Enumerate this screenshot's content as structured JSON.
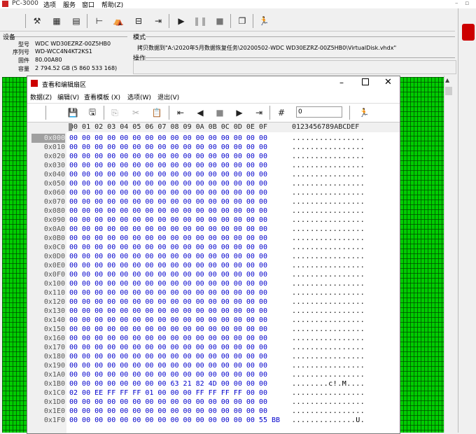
{
  "app": {
    "title": "PC-3000"
  },
  "menubar": [
    "选项",
    "服务",
    "窗口",
    "帮助(Z)"
  ],
  "device": {
    "group_label": "设备",
    "model_label": "型号",
    "model": "WDC WD30EZRZ-00Z5HB0",
    "serial_label": "序列号",
    "serial": "WD-WCC4N4KT2KS1",
    "fw_label": "固件",
    "fw": "80.00A80",
    "capacity_label": "容量",
    "capacity": "2 794.52 GB (5 860 533 168)"
  },
  "mode": {
    "label": "模式",
    "text": "拷贝数据到\"A:\\2020年5月数据恢复任务\\20200502-WDC WD30EZRZ-00Z5HB0\\VirtualDisk.vhdx\""
  },
  "operation": {
    "label": "操作"
  },
  "window": {
    "title": "查看和编辑扇区",
    "menu": [
      "数据(Z)",
      "编辑(V)",
      "查看模板 (X)",
      "选项(W)",
      "退出(V)"
    ],
    "offset_value": "0",
    "header_cols": "00 01 02 03 04 05 06 07 08 09 0A 0B 0C 0D 0E 0F",
    "header_ascii": "0123456789ABCDEF",
    "rows": [
      {
        "addr": "0x000",
        "bytes": "00 00 00 00 00 00 00 00 00 00 00 00 00 00 00 00",
        "ascii": "................"
      },
      {
        "addr": "0x010",
        "bytes": "00 00 00 00 00 00 00 00 00 00 00 00 00 00 00 00",
        "ascii": "................"
      },
      {
        "addr": "0x020",
        "bytes": "00 00 00 00 00 00 00 00 00 00 00 00 00 00 00 00",
        "ascii": "................"
      },
      {
        "addr": "0x030",
        "bytes": "00 00 00 00 00 00 00 00 00 00 00 00 00 00 00 00",
        "ascii": "................"
      },
      {
        "addr": "0x040",
        "bytes": "00 00 00 00 00 00 00 00 00 00 00 00 00 00 00 00",
        "ascii": "................"
      },
      {
        "addr": "0x050",
        "bytes": "00 00 00 00 00 00 00 00 00 00 00 00 00 00 00 00",
        "ascii": "................"
      },
      {
        "addr": "0x060",
        "bytes": "00 00 00 00 00 00 00 00 00 00 00 00 00 00 00 00",
        "ascii": "................"
      },
      {
        "addr": "0x070",
        "bytes": "00 00 00 00 00 00 00 00 00 00 00 00 00 00 00 00",
        "ascii": "................"
      },
      {
        "addr": "0x080",
        "bytes": "00 00 00 00 00 00 00 00 00 00 00 00 00 00 00 00",
        "ascii": "................"
      },
      {
        "addr": "0x090",
        "bytes": "00 00 00 00 00 00 00 00 00 00 00 00 00 00 00 00",
        "ascii": "................"
      },
      {
        "addr": "0x0A0",
        "bytes": "00 00 00 00 00 00 00 00 00 00 00 00 00 00 00 00",
        "ascii": "................"
      },
      {
        "addr": "0x0B0",
        "bytes": "00 00 00 00 00 00 00 00 00 00 00 00 00 00 00 00",
        "ascii": "................"
      },
      {
        "addr": "0x0C0",
        "bytes": "00 00 00 00 00 00 00 00 00 00 00 00 00 00 00 00",
        "ascii": "................"
      },
      {
        "addr": "0x0D0",
        "bytes": "00 00 00 00 00 00 00 00 00 00 00 00 00 00 00 00",
        "ascii": "................"
      },
      {
        "addr": "0x0E0",
        "bytes": "00 00 00 00 00 00 00 00 00 00 00 00 00 00 00 00",
        "ascii": "................"
      },
      {
        "addr": "0x0F0",
        "bytes": "00 00 00 00 00 00 00 00 00 00 00 00 00 00 00 00",
        "ascii": "................"
      },
      {
        "addr": "0x100",
        "bytes": "00 00 00 00 00 00 00 00 00 00 00 00 00 00 00 00",
        "ascii": "................"
      },
      {
        "addr": "0x110",
        "bytes": "00 00 00 00 00 00 00 00 00 00 00 00 00 00 00 00",
        "ascii": "................"
      },
      {
        "addr": "0x120",
        "bytes": "00 00 00 00 00 00 00 00 00 00 00 00 00 00 00 00",
        "ascii": "................"
      },
      {
        "addr": "0x130",
        "bytes": "00 00 00 00 00 00 00 00 00 00 00 00 00 00 00 00",
        "ascii": "................"
      },
      {
        "addr": "0x140",
        "bytes": "00 00 00 00 00 00 00 00 00 00 00 00 00 00 00 00",
        "ascii": "................"
      },
      {
        "addr": "0x150",
        "bytes": "00 00 00 00 00 00 00 00 00 00 00 00 00 00 00 00",
        "ascii": "................"
      },
      {
        "addr": "0x160",
        "bytes": "00 00 00 00 00 00 00 00 00 00 00 00 00 00 00 00",
        "ascii": "................"
      },
      {
        "addr": "0x170",
        "bytes": "00 00 00 00 00 00 00 00 00 00 00 00 00 00 00 00",
        "ascii": "................"
      },
      {
        "addr": "0x180",
        "bytes": "00 00 00 00 00 00 00 00 00 00 00 00 00 00 00 00",
        "ascii": "................"
      },
      {
        "addr": "0x190",
        "bytes": "00 00 00 00 00 00 00 00 00 00 00 00 00 00 00 00",
        "ascii": "................"
      },
      {
        "addr": "0x1A0",
        "bytes": "00 00 00 00 00 00 00 00 00 00 00 00 00 00 00 00",
        "ascii": "................"
      },
      {
        "addr": "0x1B0",
        "bytes": "00 00 00 00 00 00 00 00 63 21 82 4D 00 00 00 00",
        "ascii": "........c!.M...."
      },
      {
        "addr": "0x1C0",
        "bytes": "02 00 EE FF FF FF 01 00 00 00 FF FF FF FF 00 00",
        "ascii": "................"
      },
      {
        "addr": "0x1D0",
        "bytes": "00 00 00 00 00 00 00 00 00 00 00 00 00 00 00 00",
        "ascii": "................"
      },
      {
        "addr": "0x1E0",
        "bytes": "00 00 00 00 00 00 00 00 00 00 00 00 00 00 00 00",
        "ascii": "................"
      },
      {
        "addr": "0x1F0",
        "bytes": "00 00 00 00 00 00 00 00 00 00 00 00 00 00 00 55 BB",
        "ascii": "..............U."
      }
    ]
  },
  "colors": {
    "map_green": "#00cc00",
    "hex_blue": "#0000cc",
    "accent_red": "#cc0000"
  }
}
